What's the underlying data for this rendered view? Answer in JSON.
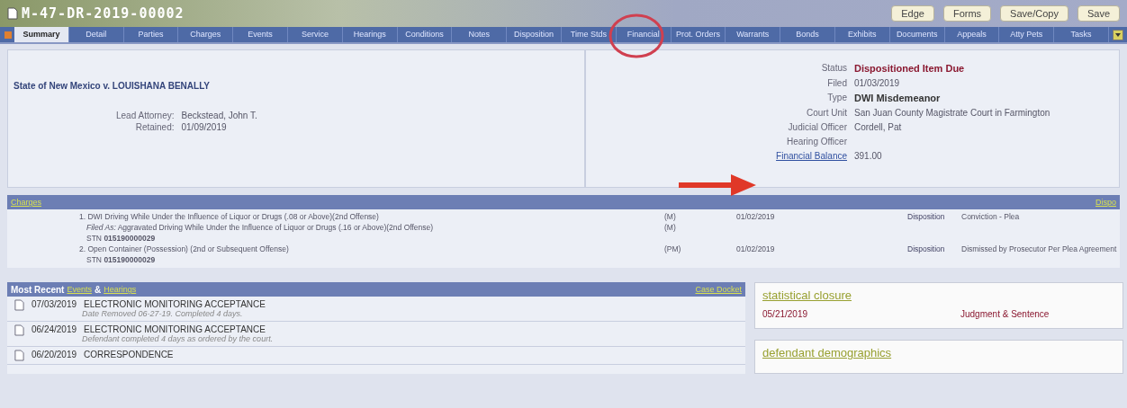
{
  "case_number": "M-47-DR-2019-00002",
  "header_buttons": [
    "Edge",
    "Forms",
    "Save/Copy",
    "Save"
  ],
  "tabs": [
    {
      "label": "Summary",
      "selected": true
    },
    {
      "label": "Detail",
      "selected": false
    },
    {
      "label": "Parties",
      "selected": false
    },
    {
      "label": "Charges",
      "selected": false
    },
    {
      "label": "Events",
      "selected": false
    },
    {
      "label": "Service",
      "selected": false
    },
    {
      "label": "Hearings",
      "selected": false
    },
    {
      "label": "Conditions",
      "selected": false
    },
    {
      "label": "Notes",
      "selected": false
    },
    {
      "label": "Disposition",
      "selected": false
    },
    {
      "label": "Time Stds",
      "selected": false
    },
    {
      "label": "Financial",
      "selected": false
    },
    {
      "label": "Prot. Orders",
      "selected": false
    },
    {
      "label": "Warrants",
      "selected": false
    },
    {
      "label": "Bonds",
      "selected": false
    },
    {
      "label": "Exhibits",
      "selected": false
    },
    {
      "label": "Documents",
      "selected": false
    },
    {
      "label": "Appeals",
      "selected": false
    },
    {
      "label": "Atty Pets",
      "selected": false
    },
    {
      "label": "Tasks",
      "selected": false
    }
  ],
  "case_title": "State of New Mexico v. LOUISHANA BENALLY",
  "attorney": [
    {
      "label": "Lead Attorney:",
      "value": "Beckstead, John T."
    },
    {
      "label": "Retained:",
      "value": "01/09/2019"
    }
  ],
  "details": [
    {
      "label": "Status",
      "value": "Dispositioned Item Due",
      "kind": "status"
    },
    {
      "label": "Filed",
      "value": "01/03/2019",
      "kind": "plain"
    },
    {
      "label": "Type",
      "value": "DWI Misdemeanor",
      "kind": "bold"
    },
    {
      "label": "Court Unit",
      "value": "San Juan County Magistrate Court in Farmington",
      "kind": "plain"
    },
    {
      "label": "Judicial Officer",
      "value": "Cordell, Pat",
      "kind": "plain"
    },
    {
      "label": "Hearing Officer",
      "kind": "plain"
    },
    {
      "label": "Financial Balance",
      "value": "391.00",
      "kind": "link"
    }
  ],
  "charges": {
    "title": "Charges",
    "right": "Dispo",
    "rows": [
      {
        "kind": "charge",
        "text": "1. DWI Driving While Under the Influence of Liquor or Drugs (.08 or Above)(2nd Offense)",
        "degree": "(M)",
        "date": "01/02/2019",
        "disp_label": "Disposition",
        "disp": "Conviction - Plea"
      },
      {
        "kind": "filed",
        "label": "Filed As:",
        "text": "Aggravated Driving While Under the Influence of Liquor or Drugs (.16 or Above)(2nd Offense)",
        "degree": "(M)"
      },
      {
        "kind": "stn",
        "label": "STN",
        "text": "015190000029"
      },
      {
        "kind": "charge",
        "text": "2. Open Container (Possession) (2nd or Subsequent Offense)",
        "degree": "(PM)",
        "date": "01/02/2019",
        "disp_label": "Disposition",
        "disp": "Dismissed by Prosecutor Per Plea Agreement"
      },
      {
        "kind": "stn",
        "label": "STN",
        "text": "015190000029"
      }
    ]
  },
  "recent": {
    "title": "Most Recent",
    "events_link": "Events",
    "amp": "&",
    "hearings_link": "Hearings",
    "docket": "Case Docket",
    "items": [
      {
        "date": "07/03/2019",
        "title": "ELECTRONIC MONITORING ACCEPTANCE",
        "note": "Date Removed 06-27-19. Completed 4 days."
      },
      {
        "date": "06/24/2019",
        "title": "ELECTRONIC MONITORING ACCEPTANCE",
        "note": "Defendant completed 4 days as ordered by the court."
      },
      {
        "date": "06/20/2019",
        "title": "CORRESPONDENCE"
      }
    ]
  },
  "cards": [
    {
      "title": "statistical closure",
      "date": "05/21/2019",
      "value": "Judgment & Sentence"
    },
    {
      "title": "defendant demographics"
    }
  ]
}
